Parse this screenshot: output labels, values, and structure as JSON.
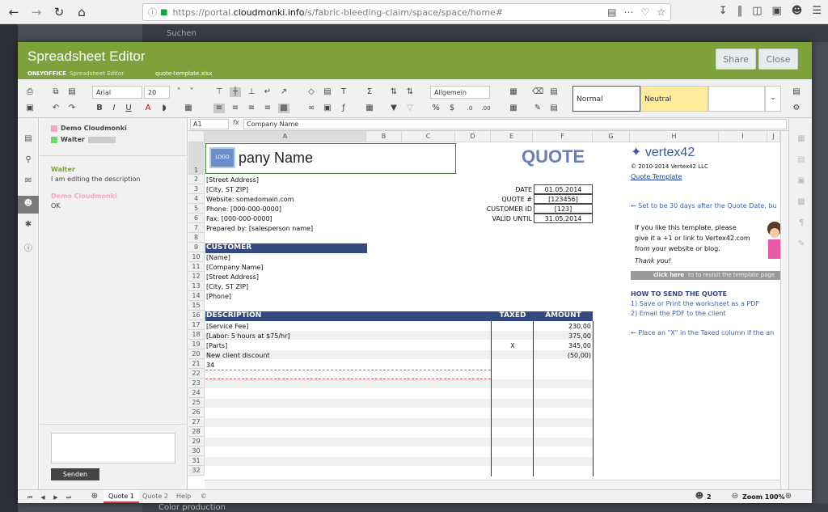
{
  "browser": {
    "url_prefix": "https://portal.",
    "url_host": "cloudmonki.info",
    "url_path": "/s/fabric-bleeding-claim/space/space/home#",
    "info_icon": "info-icon",
    "lock_icon": "lock-icon"
  },
  "background": {
    "top_text": "Suchen",
    "bottom_text": "Color production"
  },
  "modal": {
    "title": "Spreadsheet Editor",
    "brand": "ONLYOFFICE",
    "brand_sub": "Spreadsheet Editor",
    "filename": "quote-template.xlsx",
    "share_label": "Share",
    "close_label": "Close"
  },
  "toolbar": {
    "font_name": "Arial",
    "font_size": "20",
    "number_format": "Allgemein",
    "style_normal": "Normal",
    "style_neutral": "Neutral"
  },
  "chat": {
    "users": [
      {
        "name": "Demo Cloudmonki",
        "color": "#f4a6c6"
      },
      {
        "name": "Walter",
        "color": "#6fd86f"
      }
    ],
    "messages": [
      {
        "name": "Walter",
        "text": "I am editing the description",
        "color": "#7da23c"
      },
      {
        "name": "Demo Cloudmonki",
        "text": "OK",
        "color": "#f4a6c6"
      }
    ],
    "send_label": "Senden"
  },
  "formula_bar": {
    "cell_ref": "A1",
    "fx": "fx",
    "content": "Company Name"
  },
  "columns": [
    "A",
    "B",
    "C",
    "D",
    "E",
    "F",
    "G",
    "H",
    "I",
    "J"
  ],
  "rows": [
    "1",
    "2",
    "3",
    "4",
    "5",
    "6",
    "7",
    "8",
    "9",
    "10",
    "11",
    "12",
    "13",
    "14",
    "15",
    "16",
    "17",
    "18",
    "19",
    "20",
    "21",
    "22",
    "23",
    "24",
    "25",
    "26",
    "27",
    "28",
    "29",
    "30",
    "31",
    "32"
  ],
  "sheet": {
    "logo_text": "LOGO",
    "company_name": "pany Name",
    "quote_title": "QUOTE",
    "address": [
      "[Street Address]",
      "[City, ST  ZIP]",
      "Website: somedomain.com",
      "Phone: [000-000-0000]",
      "Fax: [000-000-0000]",
      "Prepared by: [salesperson name]"
    ],
    "meta_labels": [
      "DATE",
      "QUOTE #",
      "CUSTOMER ID",
      "VALID UNTIL"
    ],
    "meta_values": [
      "01.05.2014",
      "[123456]",
      "[123]",
      "31.05.2014"
    ],
    "customer_header": "CUSTOMER",
    "customer": [
      "[Name]",
      "[Company Name]",
      "[Street Address]",
      "[City, ST  ZIP]",
      "[Phone]"
    ],
    "desc_header": "DESCRIPTION",
    "taxed_header": "TAXED",
    "amount_header": "AMOUNT",
    "items": [
      {
        "desc": "[Service Fee]",
        "taxed": "",
        "amount": "230,00"
      },
      {
        "desc": "[Labor: 5 hours at $75/hr]",
        "taxed": "",
        "amount": "375,00"
      },
      {
        "desc": "[Parts]",
        "taxed": "X",
        "amount": "345,00"
      },
      {
        "desc": "New client discount",
        "taxed": "",
        "amount": "(50,00)"
      },
      {
        "desc": "34",
        "taxed": "",
        "amount": ""
      }
    ],
    "vertex_logo": "vertex42",
    "copyright": "© 2010-2014 Vertex42 LLC",
    "template_link": "Quote Template",
    "note_30days": "← Set to be 30 days after the Quote Date, bu",
    "promo": [
      "If you like this template, please",
      "give it a +1 or link to Vertex42.com",
      "from your website or blog."
    ],
    "thank_you": "Thank you!",
    "click_here": "click here",
    "revisit": "to to revisit the template page",
    "how_to_title": "HOW TO SEND THE QUOTE",
    "how_to": [
      "1) Save or Print the worksheet as a PDF",
      "2) Email the PDF to the client"
    ],
    "taxed_note": "← Place an \"X\" in the Taxed column if the an"
  },
  "status": {
    "tabs": [
      "Quote 1",
      "Quote 2",
      "Help",
      "©"
    ],
    "active_tab": "Quote 1",
    "users_count": "2",
    "zoom": "Zoom 100%"
  }
}
